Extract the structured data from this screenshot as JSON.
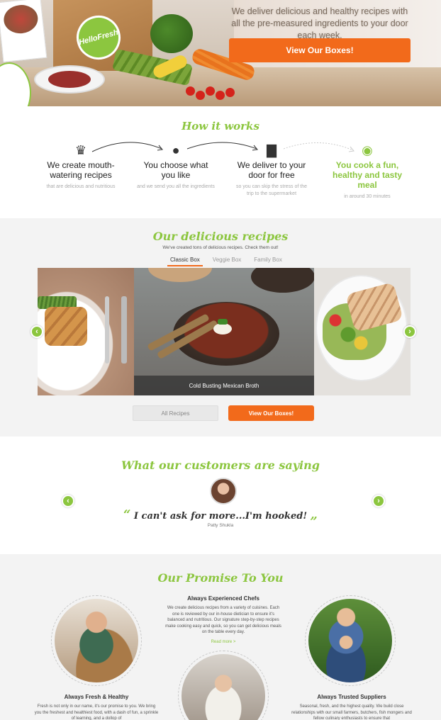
{
  "hero": {
    "tagline": "We deliver delicious and healthy recipes with all the pre-measured ingredients to your door each week.",
    "cta_label": "View Our Boxes!",
    "box_logo": "HelloFresh"
  },
  "how": {
    "title": "How it works",
    "steps": [
      {
        "icon": "chef-hat-icon",
        "glyph": "♛",
        "title": "We create mouth-watering recipes",
        "sub": "that are delicious and nutritious"
      },
      {
        "icon": "tomato-icon",
        "glyph": "●",
        "title": "You choose what you like",
        "sub": "and we send you all the ingredients"
      },
      {
        "icon": "delivery-truck-icon",
        "glyph": "▇",
        "title": "We deliver to your door for free",
        "sub": "so you can skip the stress of the trip to the supermarket"
      },
      {
        "icon": "plate-cutlery-icon",
        "glyph": "◉",
        "title": "You cook a fun, healthy and tasty meal",
        "sub": "in around 30 minutes"
      }
    ]
  },
  "recipes": {
    "title": "Our delicious recipes",
    "subtitle": "We've created tons of delicious recipes. Check them out!",
    "tabs": [
      "Classic Box",
      "Veggie Box",
      "Family Box"
    ],
    "active_tab": "Classic Box",
    "caption": "Cold Busting Mexican Broth",
    "prev": "‹",
    "next": "›",
    "all_label": "All Recipes",
    "view_label": "View Our Boxes!"
  },
  "testimonial": {
    "title": "What our customers are saying",
    "open_quote": "“",
    "quote": "I can't ask for more...I'm hooked!",
    "close_quote": "„",
    "author": "Patty Shukla",
    "prev": "‹",
    "next": "›"
  },
  "promise": {
    "title": "Our Promise To You",
    "items": [
      {
        "heading": "Always Experienced Chefs",
        "body": "We create delicious recipes from a variety of cuisines. Each one is reviewed by our in-house dietician to ensure it's balanced and nutritious. Our signature step-by-step recipes make cooking easy and quick, so you can get delicious meals on the table every day.",
        "more": "Read more >"
      },
      {
        "heading": "Always Fresh & Healthy",
        "body": "Fresh is not only in our name, it's our promise to you. We bring you the freshest and healthiest food, with a dash of fun, a sprinkle of learning, and a dollop of"
      },
      {
        "heading": "Always Trusted Suppliers",
        "body": "Seasonal, fresh, and the highest quality. We build close relationships with our small farmers, butchers, fish mongers and fellow culinary enthusiasts to ensure that"
      }
    ]
  },
  "colors": {
    "brand_green": "#8cc63f",
    "accent_orange": "#f26a1b"
  }
}
